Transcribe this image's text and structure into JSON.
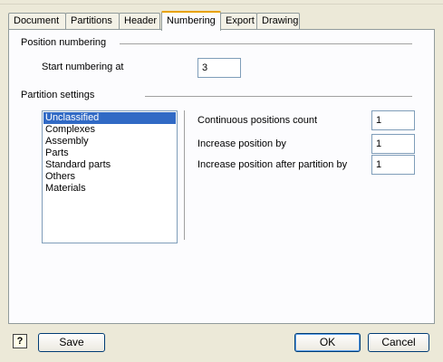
{
  "tabs": [
    "Document",
    "Partitions",
    "Header",
    "Numbering",
    "Export",
    "Drawing"
  ],
  "active_tab": "Numbering",
  "position_numbering": {
    "heading": "Position numbering",
    "start_label": "Start numbering at",
    "start_value": "3"
  },
  "partition_settings": {
    "heading": "Partition settings",
    "items": [
      "Unclassified",
      "Complexes",
      "Assembly",
      "Parts",
      "Standard parts",
      "Others",
      "Materials"
    ],
    "selected": "Unclassified",
    "fields": [
      {
        "label": "Continuous positions count",
        "value": "1"
      },
      {
        "label": "Increase position by",
        "value": "1"
      },
      {
        "label": "Increase position after partition by",
        "value": "1"
      }
    ]
  },
  "buttons": {
    "save": "Save",
    "ok": "OK",
    "cancel": "Cancel"
  },
  "icons": {
    "help": "help-icon",
    "help_glyph": "?"
  },
  "colors": {
    "selection": "#316ac5",
    "active_tab_highlight": "#e8a200"
  }
}
